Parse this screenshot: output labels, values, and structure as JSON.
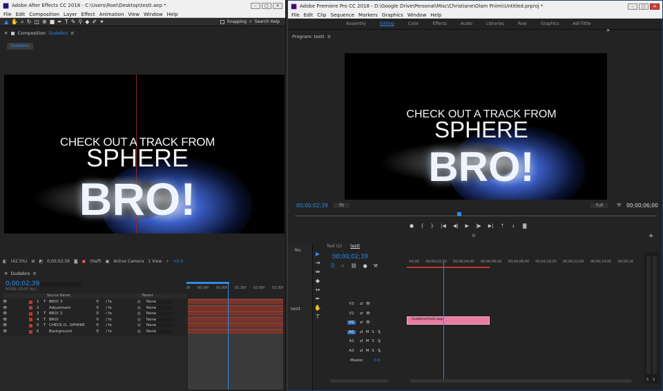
{
  "ae": {
    "title": "Adobe After Effects CC 2018 - C:\\Users\\Roei\\Desktop\\testt.aep *",
    "menu": [
      "File",
      "Edit",
      "Composition",
      "Layer",
      "Effect",
      "Animation",
      "View",
      "Window",
      "Help"
    ],
    "snapping": "Snapping",
    "search_placeholder": "Search Help",
    "comp_panel_label": "Composition",
    "comp_name": "Dudebro",
    "comp_tab": "Dudebro",
    "frame": {
      "line1": "CHECK OUT A TRACK FROM",
      "line2": "SPHERE",
      "line3": "BRO!"
    },
    "viewer_bar": {
      "zoom": "(42.5%)",
      "timecode": "0;00;02;39",
      "resolution": "(Half)",
      "camera": "Active Camera",
      "views": "1 View",
      "exposure": "+0.0"
    },
    "timeline": {
      "tab": "Dudebro",
      "timecode": "0;00;02;39",
      "fps": "00089 (29.97 fps)",
      "ruler": [
        "0f",
        "00:30f",
        "01:00f",
        "01:30f",
        "02:00f",
        "02:30f"
      ],
      "col_source": "Source Name",
      "col_parent": "Parent",
      "layers": [
        {
          "num": "1",
          "type": "T",
          "name": "BRO! 3",
          "parent": "None"
        },
        {
          "num": "2",
          "type": "",
          "name": "Adjustment",
          "parent": "None"
        },
        {
          "num": "3",
          "type": "T",
          "name": "BRO! 2",
          "parent": "None"
        },
        {
          "num": "4",
          "type": "T",
          "name": "BRO!",
          "parent": "None"
        },
        {
          "num": "5",
          "type": "T",
          "name": "CHECK O...SPHERE",
          "parent": "None"
        },
        {
          "num": "6",
          "type": "",
          "name": "Background",
          "parent": "None"
        }
      ]
    }
  },
  "pr": {
    "title": "Adobe Premiere Pro CC 2018 - D:\\Google Drive\\Personal\\Misc\\Christiane\\Olam Pnimi\\Untitled.prproj *",
    "menu": [
      "File",
      "Edit",
      "Clip",
      "Sequence",
      "Markers",
      "Graphics",
      "Window",
      "Help"
    ],
    "workspaces": [
      "Assembly",
      "Editing",
      "Color",
      "Effects",
      "Audio",
      "Libraries",
      "Roei",
      "Graphics",
      "Adi-Tittle"
    ],
    "active_workspace": "Editing",
    "program_label": "Program: testt",
    "program_timecode": "00;00;02;39",
    "fit": "Fit",
    "quality": "Full",
    "duration": "00;00;06;00",
    "project_label": "No.",
    "project_item": "testt",
    "seq_tabs": [
      "Test (2)",
      "testt"
    ],
    "seq_timecode": "00;00;02;39",
    "seq_ruler": [
      ":00;00",
      "00;00;02;00",
      "00;00;04;00",
      "00;00;06;00",
      "00;00;08;00",
      "00;00;10;00",
      "00;00;12;00",
      "00;00;14;00",
      "00;00;16"
    ],
    "tracks": {
      "video": [
        "V3",
        "V2",
        "V1"
      ],
      "audio": [
        "A1",
        "A2",
        "A3"
      ],
      "master": "Master",
      "master_val": "0.0"
    },
    "clip_name": "Dudebro/testt.aep",
    "meter_labels": [
      "S",
      "S"
    ]
  },
  "colors": {
    "accent": "#2d8ceb",
    "clip": "#e97aa2",
    "layer_bar": "#7a3329"
  }
}
